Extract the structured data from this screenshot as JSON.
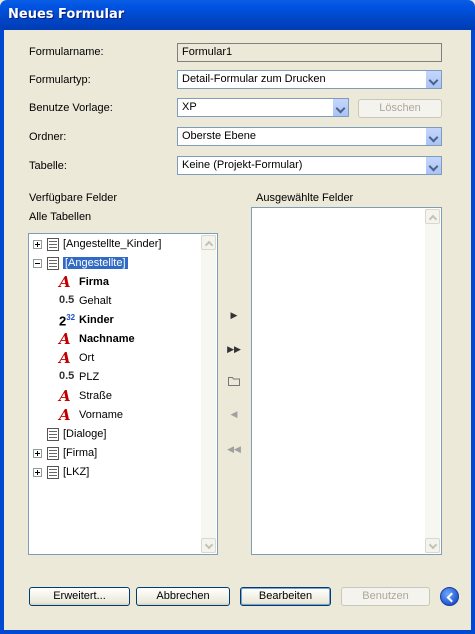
{
  "window": {
    "title": "Neues Formular"
  },
  "form": {
    "name_label": "Formularname:",
    "name_value": "Formular1",
    "type_label": "Formulartyp:",
    "type_value": "Detail-Formular zum Drucken",
    "template_label": "Benutze Vorlage:",
    "template_value": "XP",
    "delete_label": "Löschen",
    "folder_label": "Ordner:",
    "folder_value": "Oberste Ebene",
    "table_label": "Tabelle:",
    "table_value": "Keine (Projekt-Formular)"
  },
  "available": {
    "heading": "Verfügbare Felder",
    "subheading": "Alle Tabellen",
    "tree": [
      {
        "label": "[Angestellte_Kinder]",
        "kind": "table",
        "expander": "plus"
      },
      {
        "label": "[Angestellte]",
        "kind": "table",
        "expander": "minus",
        "selected": true
      },
      {
        "label": "Firma",
        "kind": "field",
        "icon": "text",
        "bold": true
      },
      {
        "label": "Gehalt",
        "kind": "field",
        "icon": "num",
        "bold": false
      },
      {
        "label": "Kinder",
        "kind": "field",
        "icon": "int",
        "bold": true
      },
      {
        "label": "Nachname",
        "kind": "field",
        "icon": "text",
        "bold": true
      },
      {
        "label": "Ort",
        "kind": "field",
        "icon": "text",
        "bold": false
      },
      {
        "label": "PLZ",
        "kind": "field",
        "icon": "num",
        "bold": false
      },
      {
        "label": "Straße",
        "kind": "field",
        "icon": "text",
        "bold": false
      },
      {
        "label": "Vorname",
        "kind": "field",
        "icon": "text",
        "bold": false
      },
      {
        "label": "[Dialoge]",
        "kind": "table",
        "expander": "none"
      },
      {
        "label": "[Firma]",
        "kind": "table",
        "expander": "plus"
      },
      {
        "label": "[LKZ]",
        "kind": "table",
        "expander": "plus"
      }
    ],
    "icon_glyphs": {
      "num": "0.5",
      "int_base": "2",
      "int_sup": "32"
    }
  },
  "selected_fields": {
    "heading": "Ausgewählte Felder"
  },
  "buttons": {
    "advanced": "Erweitert...",
    "cancel": "Abbrechen",
    "edit": "Bearbeiten",
    "use": "Benutzen"
  },
  "colors": {
    "accent": "#316ac5",
    "titlebar": "#0054e3",
    "text_field_icon": "#c00000"
  }
}
